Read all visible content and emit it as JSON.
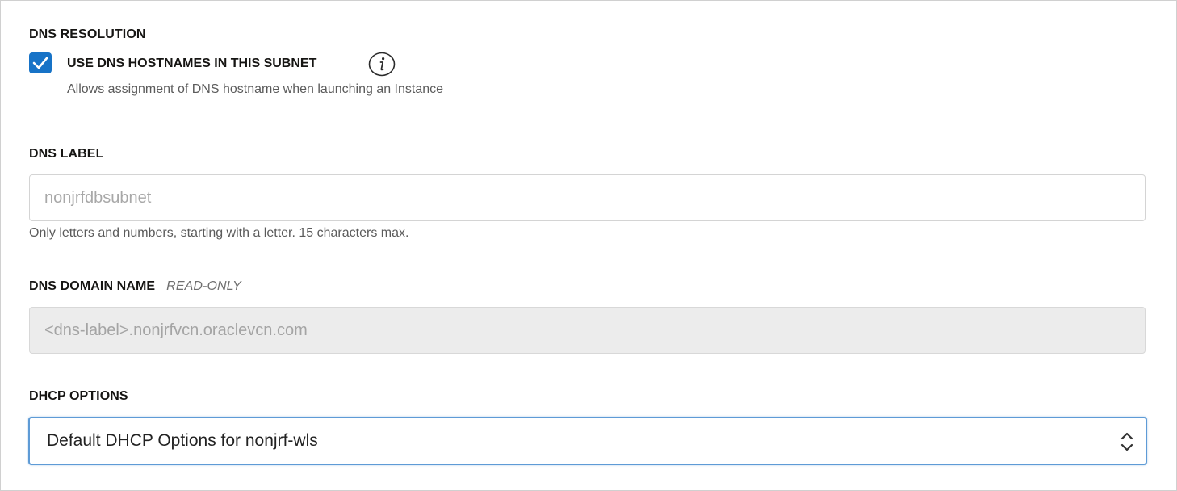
{
  "dns_resolution": {
    "section_label": "DNS RESOLUTION",
    "checkbox_checked": true,
    "checkbox_label": "USE DNS HOSTNAMES IN THIS SUBNET",
    "info_icon": "info-icon",
    "helper_text": "Allows assignment of DNS hostname when launching an Instance"
  },
  "dns_label": {
    "section_label": "DNS LABEL",
    "value": "",
    "placeholder": "nonjrfdbsubnet",
    "helper_text": "Only letters and numbers, starting with a letter. 15 characters max."
  },
  "dns_domain_name": {
    "section_label": "DNS DOMAIN NAME",
    "readonly_tag": "READ-ONLY",
    "value": "<dns-label>.nonjrfvcn.oraclevcn.com"
  },
  "dhcp_options": {
    "section_label": "DHCP OPTIONS",
    "selected_value": "Default DHCP Options for nonjrf-wls",
    "icon": "chevrons-up-down-icon"
  },
  "colors": {
    "accent": "#1773c7",
    "focus_border": "#5e9bd6",
    "readonly_bg": "#ececec"
  }
}
